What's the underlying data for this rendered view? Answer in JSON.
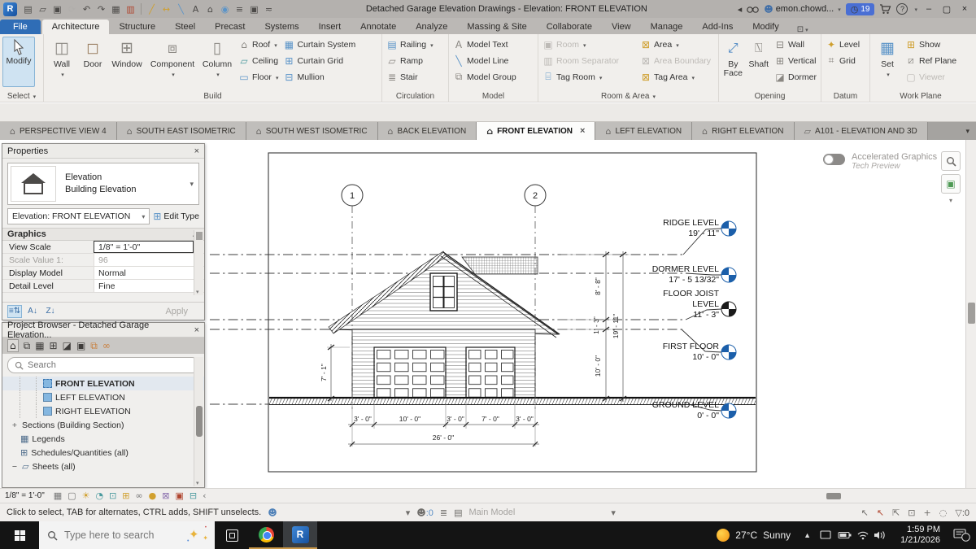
{
  "titlebar": {
    "logo": "R",
    "title": "Detached Garage Elevation Drawings - Elevation: FRONT ELEVATION",
    "user": "emon.chowd...",
    "clock_badge": "19"
  },
  "ribbon_tabs": {
    "items": [
      "File",
      "Architecture",
      "Structure",
      "Steel",
      "Precast",
      "Systems",
      "Insert",
      "Annotate",
      "Analyze",
      "Massing & Site",
      "Collaborate",
      "View",
      "Manage",
      "Add-Ins",
      "Modify"
    ]
  },
  "ribbon": {
    "modify": "Modify",
    "select_label": "Select",
    "build": {
      "label": "Build",
      "large": [
        "Wall",
        "Door",
        "Window",
        "Component",
        "Column"
      ],
      "col1": [
        "Roof",
        "Ceiling",
        "Floor"
      ],
      "col2": [
        "Curtain System",
        "Curtain Grid",
        "Mullion"
      ]
    },
    "circulation": {
      "label": "Circulation",
      "items": [
        "Railing",
        "Ramp",
        "Stair"
      ]
    },
    "model": {
      "label": "Model",
      "items": [
        "Model Text",
        "Model Line",
        "Model Group"
      ]
    },
    "room_area": {
      "label": "Room & Area",
      "col1": [
        "Room",
        "Room Separator",
        "Tag Room"
      ],
      "col2": [
        "Area",
        "Area Boundary",
        "Tag Area"
      ]
    },
    "opening": {
      "label": "Opening",
      "large": [
        "By Face",
        "Shaft"
      ],
      "col": [
        "Wall",
        "Vertical",
        "Dormer"
      ]
    },
    "datum": {
      "label": "Datum",
      "items": [
        "Level",
        "Grid"
      ]
    },
    "work_plane": {
      "label": "Work Plane",
      "set": "Set",
      "col": [
        "Show",
        "Ref Plane",
        "Viewer"
      ]
    }
  },
  "view_tabs": {
    "items": [
      "PERSPECTIVE VIEW 4",
      "SOUTH EAST ISOMETRIC",
      "SOUTH WEST ISOMETRIC",
      "BACK ELEVATION",
      "FRONT ELEVATION",
      "LEFT ELEVATION",
      "RIGHT ELEVATION",
      "A101 - ELEVATION AND 3D"
    ]
  },
  "properties": {
    "header": "Properties",
    "type_name": "Elevation",
    "type_family": "Building Elevation",
    "selector": "Elevation: FRONT ELEVATION",
    "edit_type": "Edit Type",
    "section": "Graphics",
    "rows": [
      {
        "label": "View Scale",
        "value": "1/8\" = 1'-0\""
      },
      {
        "label": "Scale Value    1:",
        "value": "96"
      },
      {
        "label": "Display Model",
        "value": "Normal"
      },
      {
        "label": "Detail Level",
        "value": "Fine"
      }
    ],
    "apply": "Apply"
  },
  "browser": {
    "header": "Project Browser - Detached Garage Elevation...",
    "search_placeholder": "Search",
    "views": [
      "FRONT ELEVATION",
      "LEFT ELEVATION",
      "RIGHT ELEVATION"
    ],
    "sections": "Sections (Building Section)",
    "legends": "Legends",
    "schedules": "Schedules/Quantities (all)",
    "sheets": "Sheets (all)"
  },
  "drawing": {
    "grid_bubbles": [
      "1",
      "2"
    ],
    "levels": [
      {
        "name": "RIDGE LEVEL",
        "value": "19' - 11\""
      },
      {
        "name": "DORMER LEVEL",
        "value": "17' - 5 13/32\""
      },
      {
        "name": "FLOOR JOIST",
        "name2": "LEVEL",
        "value": "11' - 3\""
      },
      {
        "name": "FIRST FLOOR",
        "value": "10' - 0\""
      },
      {
        "name": "GROUND LEVEL",
        "value": "0' - 0\""
      }
    ],
    "dims_bottom": [
      "3' - 0\"",
      "10' - 0\"",
      "3' - 0\"",
      "7' - 0\"",
      "3' - 0\""
    ],
    "dim_total": "26' - 0\"",
    "dims_right": [
      "8' - 8\"",
      "1' - 3\"",
      "10' - 0\""
    ],
    "dim_right_total": "19' - 11\"",
    "dim_left": "7' - 1\"",
    "accel_title": "Accelerated Graphics",
    "accel_sub": "Tech Preview"
  },
  "view_control": {
    "scale": "1/8\" = 1'-0\""
  },
  "status": {
    "hint": "Click to select, TAB for alternates, CTRL adds, SHIFT unselects.",
    "main_model": "Main Model",
    "editable_count": ":0",
    "filter_count": ":0"
  },
  "taskbar": {
    "search_placeholder": "Type here to search",
    "temp": "27°C",
    "weather": "Sunny",
    "time": "1:59 PM",
    "date": "1/21/2026",
    "notif": "1"
  },
  "colors": {
    "accent_blue": "#1b5faa",
    "level_black": "#1a1a1a",
    "file_tab_blue": "#2f6db6",
    "link_orange": "#c97f3c"
  }
}
